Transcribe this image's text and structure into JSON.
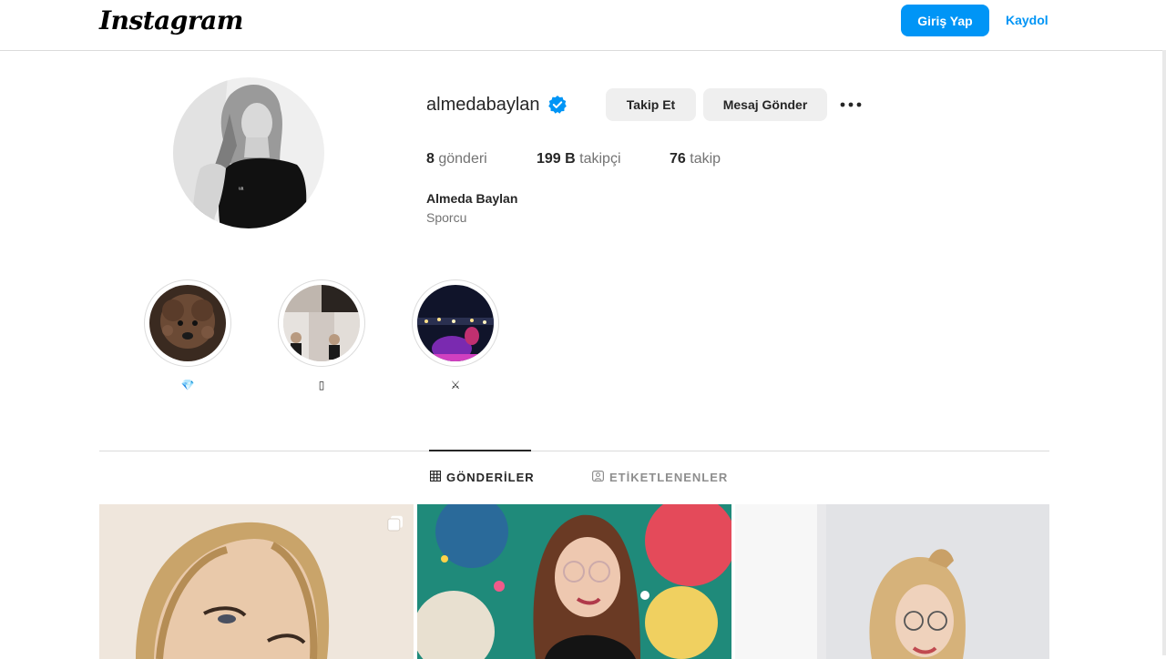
{
  "nav": {
    "logo_text": "Instagram",
    "login_label": "Giriş Yap",
    "signup_label": "Kaydol"
  },
  "profile": {
    "username": "almedabaylan",
    "verified": true,
    "follow_label": "Takip Et",
    "message_label": "Mesaj Gönder",
    "more_icon": "more-horizontal-icon",
    "stats": {
      "posts_count": "8",
      "posts_label": "gönderi",
      "followers_count": "199 B",
      "followers_label": "takipçi",
      "following_count": "76",
      "following_label": "takip"
    },
    "full_name": "Almeda Baylan",
    "category": "Sporcu"
  },
  "highlights": [
    {
      "label": "💎"
    },
    {
      "label": "▯"
    },
    {
      "label": "⚔"
    }
  ],
  "tabs": [
    {
      "label": "GÖNDERİLER",
      "icon": "grid-icon",
      "active": true
    },
    {
      "label": "ETİKETLENENLER",
      "icon": "tagged-user-icon",
      "active": false
    }
  ],
  "posts": [
    {
      "icon": "carousel-icon"
    },
    {},
    {}
  ],
  "colors": {
    "accent": "#0095f6",
    "verified": "#0095f6",
    "text": "#262626",
    "muted": "#737373",
    "border": "#dbdbdb",
    "button_bg": "#efefef"
  }
}
